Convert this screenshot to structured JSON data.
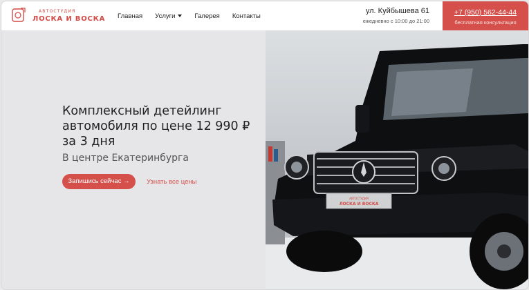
{
  "brand": {
    "small": "АВТОСТУДИЯ",
    "name": "ЛОСКА И ВОСКА",
    "color": "#d5504a"
  },
  "nav": {
    "items": [
      {
        "label": "Главная"
      },
      {
        "label": "Услуги",
        "dropdown": true
      },
      {
        "label": "Галерея"
      },
      {
        "label": "Контакты"
      }
    ]
  },
  "contact": {
    "address": "ул. Куйбышева 61",
    "hours": "ежедневно с 10:00 до 21:00",
    "phone": "+7 (950) 562-44-44",
    "phone_note": "бесплатная консультация"
  },
  "hero": {
    "headline": "Комплексный детейлинг автомобиля по цене 12 990 ₽ за 3 дня",
    "subtitle": "В центре Екатеринбурга",
    "cta_primary": "Запишись сейчас →",
    "cta_secondary": "Узнать все цены"
  },
  "image": {
    "plate_small": "АВТОСТУДИЯ",
    "plate_name": "ЛОСКА И ВОСКА"
  }
}
